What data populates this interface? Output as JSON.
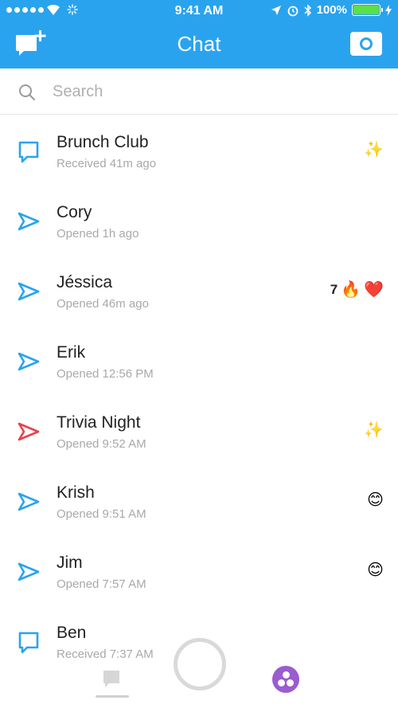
{
  "status_bar": {
    "time": "9:41 AM",
    "battery": "100%"
  },
  "header": {
    "title": "Chat"
  },
  "search": {
    "placeholder": "Search"
  },
  "chats": [
    {
      "name": "Brunch Club",
      "status": "Received 41m ago",
      "icon": "chat-bubble-icon",
      "icon_color": "#2aa3ef",
      "streak": "",
      "emojis": [
        "✨"
      ]
    },
    {
      "name": "Cory",
      "status": "Opened 1h ago",
      "icon": "sent-arrow-icon",
      "icon_color": "#2aa3ef",
      "streak": "",
      "emojis": []
    },
    {
      "name": "Jéssica",
      "status": "Opened 46m ago",
      "icon": "sent-arrow-icon",
      "icon_color": "#2aa3ef",
      "streak": "7",
      "emojis": [
        "🔥",
        "❤️"
      ]
    },
    {
      "name": "Erik",
      "status": "Opened 12:56 PM",
      "icon": "sent-arrow-icon",
      "icon_color": "#2aa3ef",
      "streak": "",
      "emojis": []
    },
    {
      "name": "Trivia Night",
      "status": "Opened 9:52 AM",
      "icon": "sent-arrow-icon",
      "icon_color": "#e8414e",
      "streak": "",
      "emojis": [
        "✨"
      ]
    },
    {
      "name": "Krish",
      "status": "Opened 9:51 AM",
      "icon": "sent-arrow-icon",
      "icon_color": "#2aa3ef",
      "streak": "",
      "emojis": [
        "😊"
      ]
    },
    {
      "name": "Jim",
      "status": "Opened 7:57 AM",
      "icon": "sent-arrow-icon",
      "icon_color": "#2aa3ef",
      "streak": "",
      "emojis": [
        "😊"
      ]
    },
    {
      "name": "Ben",
      "status": "Received 7:37 AM",
      "icon": "chat-bubble-icon",
      "icon_color": "#2aa3ef",
      "streak": "",
      "emojis": []
    }
  ],
  "colors": {
    "brand": "#2aa3ef",
    "stories": "#9a5ccf"
  }
}
